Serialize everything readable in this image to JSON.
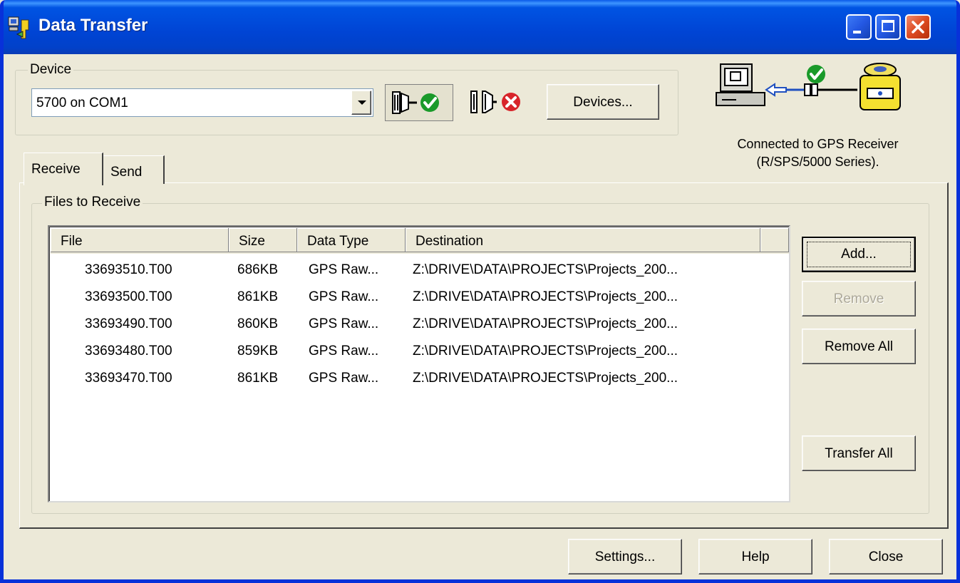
{
  "window": {
    "title": "Data Transfer"
  },
  "device": {
    "group_label": "Device",
    "selected": "5700 on COM1",
    "connect_icon": "connect-plug-check-icon",
    "disconnect_icon": "disconnect-plug-x-icon",
    "devices_button": "Devices..."
  },
  "status": {
    "line1": "Connected to GPS Receiver",
    "line2": "(R/SPS/5000 Series)."
  },
  "tabs": [
    {
      "label": "Receive",
      "active": true
    },
    {
      "label": "Send",
      "active": false
    }
  ],
  "files": {
    "group_label": "Files to Receive",
    "columns": [
      "File",
      "Size",
      "Data Type",
      "Destination"
    ],
    "rows": [
      {
        "file": "33693510.T00",
        "size": "686KB",
        "type": "GPS Raw...",
        "dest": "Z:\\DRIVE\\DATA\\PROJECTS\\Projects_200..."
      },
      {
        "file": "33693500.T00",
        "size": "861KB",
        "type": "GPS Raw...",
        "dest": "Z:\\DRIVE\\DATA\\PROJECTS\\Projects_200..."
      },
      {
        "file": "33693490.T00",
        "size": "860KB",
        "type": "GPS Raw...",
        "dest": "Z:\\DRIVE\\DATA\\PROJECTS\\Projects_200..."
      },
      {
        "file": "33693480.T00",
        "size": "859KB",
        "type": "GPS Raw...",
        "dest": "Z:\\DRIVE\\DATA\\PROJECTS\\Projects_200..."
      },
      {
        "file": "33693470.T00",
        "size": "861KB",
        "type": "GPS Raw...",
        "dest": "Z:\\DRIVE\\DATA\\PROJECTS\\Projects_200..."
      }
    ]
  },
  "side_buttons": {
    "add": "Add...",
    "remove": "Remove",
    "remove_all": "Remove All",
    "transfer_all": "Transfer All"
  },
  "footer": {
    "settings": "Settings...",
    "help": "Help",
    "close": "Close"
  },
  "colors": {
    "titlebar": "#0054e3",
    "face": "#ece9d8",
    "close_button": "#dd4b22",
    "check_green": "#1a9a2a",
    "error_red": "#d8242a"
  }
}
